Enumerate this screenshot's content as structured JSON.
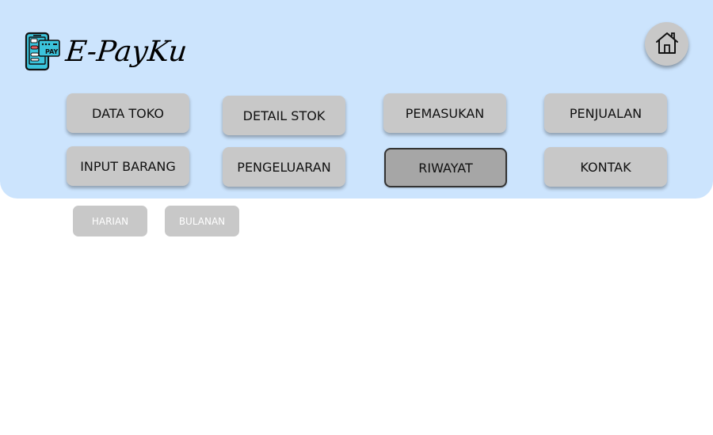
{
  "app": {
    "brand": "E-PayKu",
    "logo_badge": "PAY"
  },
  "nav": {
    "row1": [
      "DATA TOKO",
      "DETAIL STOK",
      "PEMASUKAN",
      "PENJUALAN"
    ],
    "row2": [
      "INPUT BARANG",
      "PENGELUARAN",
      "RIWAYAT",
      "KONTAK"
    ],
    "active": "RIWAYAT"
  },
  "history": {
    "tabs": [
      "HARIAN",
      "BULANAN"
    ]
  },
  "icons": {
    "home": "home-icon",
    "logo": "phone-pay-logo-icon"
  },
  "colors": {
    "header_bg": "#cce4fd",
    "button_bg": "#c8c8c8",
    "active_button_bg": "#a6a6a6",
    "logo_screen": "#3bc4dc"
  }
}
